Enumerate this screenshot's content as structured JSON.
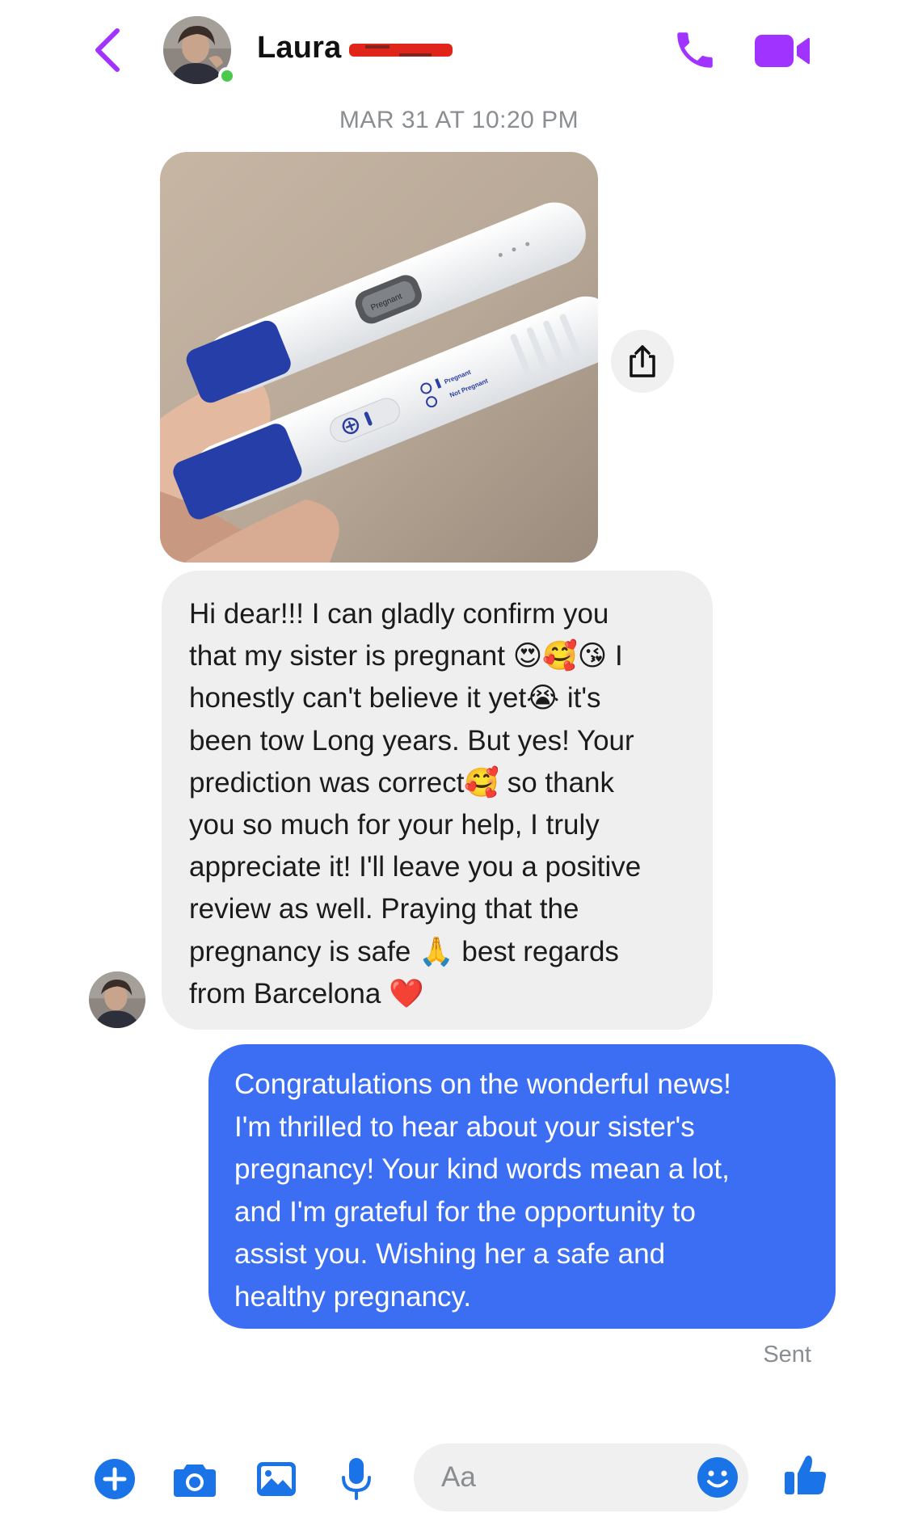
{
  "header": {
    "contact_name": "Laura",
    "contact_status": "online",
    "icons": {
      "back": "chevron-left-icon",
      "call": "phone-icon",
      "video": "video-camera-icon"
    },
    "accent_color": "#a033ff"
  },
  "thread": {
    "timestamp": "MAR 31 AT 10:20 PM",
    "photo": {
      "description_icon": "pregnancy-test-photo",
      "share_icon": "share-icon",
      "test_window_text": "Pregnant",
      "legend_pregnant": "Pregnant",
      "legend_not_pregnant": "Not Pregnant"
    },
    "received_message": "Hi dear!!! I can gladly confirm you\nthat my sister is pregnant 😍🥰😘 I\nhonestly can't believe it yet😭 it's\nbeen tow Long years. But yes! Your\nprediction was correct🥰 so thank\nyou so much for your help, I truly\nappreciate it! I'll leave you a positive\nreview as well. Praying that the\npregnancy is safe 🙏 best regards\nfrom Barcelona ❤️",
    "sent_message": "Congratulations on the wonderful news!\nI'm thrilled to hear about your sister's\npregnancy! Your kind words mean a lot,\nand I'm grateful for the opportunity to\nassist you. Wishing her a safe and\nhealthy pregnancy.",
    "sent_status": "Sent",
    "received_bubble_color": "#efefef",
    "sent_bubble_color": "#3b6ef2"
  },
  "composer": {
    "placeholder": "Aa",
    "value": "",
    "icons": {
      "plus": "plus-circle-icon",
      "camera": "camera-icon",
      "gallery": "image-icon",
      "mic": "microphone-icon",
      "emoji": "smiley-icon",
      "like": "thumbs-up-icon"
    },
    "accent_color": "#1a74e8"
  }
}
